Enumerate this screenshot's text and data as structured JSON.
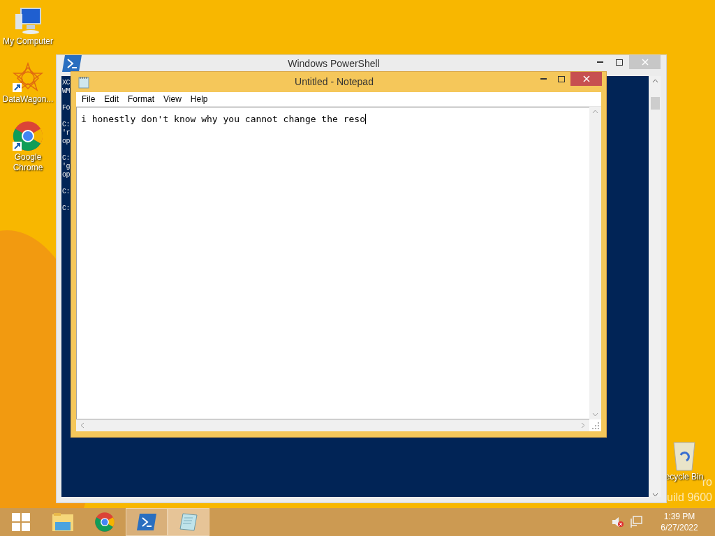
{
  "desktop_icons": [
    {
      "kind": "computer",
      "label": "My Computer"
    },
    {
      "kind": "datawagon",
      "label": "DataWagon..."
    },
    {
      "kind": "chrome",
      "label": "Google Chrome"
    }
  ],
  "recycle_bin": {
    "label": "ecycle Bin"
  },
  "edition_text": [
    "ro",
    "uild 9600"
  ],
  "powershell": {
    "title": "Windows PowerShell",
    "console_blocks": [
      [
        "XC",
        "WM"
      ],
      [
        "Fo"
      ],
      [
        "C:",
        "'r",
        "op"
      ],
      [
        "C:",
        "'g",
        "op"
      ],
      [
        "C:"
      ],
      [
        "C:"
      ]
    ]
  },
  "notepad": {
    "title": "Untitled - Notepad",
    "menu": [
      "File",
      "Edit",
      "Format",
      "View",
      "Help"
    ],
    "text": "i honestly don't know why you cannot change the reso"
  },
  "taskbar": {
    "items": [
      {
        "kind": "start",
        "running": false,
        "selected": false
      },
      {
        "kind": "explorer",
        "running": false,
        "selected": false
      },
      {
        "kind": "chrome",
        "running": false,
        "selected": false
      },
      {
        "kind": "powershell",
        "running": true,
        "selected": false
      },
      {
        "kind": "notepad",
        "running": true,
        "selected": true
      }
    ],
    "time": "1:39 PM",
    "date": "6/27/2022"
  }
}
